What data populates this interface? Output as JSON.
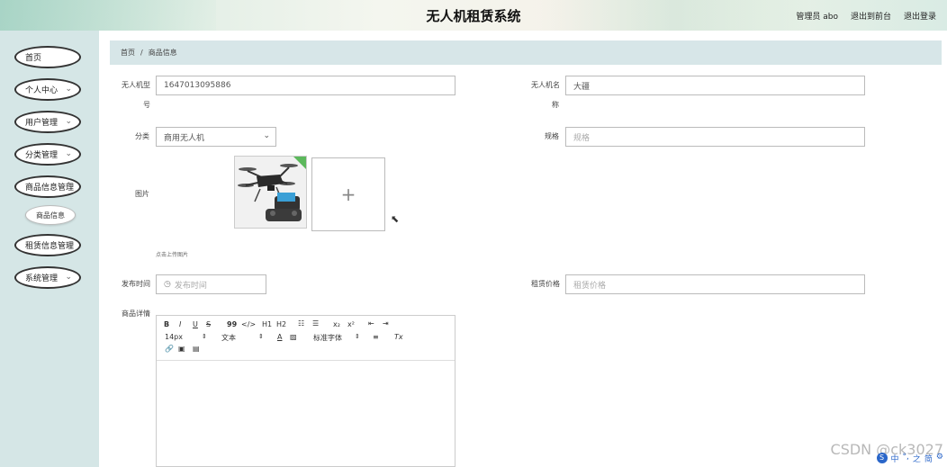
{
  "header": {
    "title": "无人机租赁系统",
    "links": [
      "管理员 abo",
      "退出到前台",
      "退出登录"
    ]
  },
  "sidebar": {
    "items": [
      {
        "label": "首页"
      },
      {
        "label": "个人中心"
      },
      {
        "label": "用户管理"
      },
      {
        "label": "分类管理"
      },
      {
        "label": "商品信息管理"
      },
      {
        "label": "商品信息",
        "sub": true
      },
      {
        "label": "租赁信息管理"
      },
      {
        "label": "系统管理"
      }
    ]
  },
  "breadcrumb": {
    "home": "首页",
    "sep": "/",
    "current": "商品信息"
  },
  "form": {
    "model_label_1": "无人机型",
    "model_label_2": "号",
    "model_value": "1647013095886",
    "name_label_1": "无人机名",
    "name_label_2": "称",
    "name_value": "大疆",
    "category_label": "分类",
    "category_value": "商用无人机",
    "spec_label": "规格",
    "spec_placeholder": "规格",
    "image_label": "图片",
    "upload_hint": "点击上传图片",
    "publish_label": "发布时间",
    "publish_placeholder": "发布时间",
    "price_label": "租赁价格",
    "price_placeholder": "租赁价格",
    "detail_label": "商品详情"
  },
  "editor": {
    "font_size": "14px",
    "paragraph": "文本",
    "font_family": "标准字体",
    "btn_bold": "B",
    "btn_italic": "I",
    "btn_underline": "U",
    "btn_strike": "S",
    "btn_quote": "99",
    "btn_code": "</>",
    "btn_h1": "H1",
    "btn_h2": "H2",
    "btn_sub": "x₂",
    "btn_sup": "x²",
    "btn_color": "A",
    "btn_clear": "Tx"
  },
  "watermark": "CSDN @ck3027",
  "ime": [
    "中",
    "°,",
    "之",
    "简",
    "⚙"
  ],
  "colors": {
    "sidebar_bg": "#d5e6e6",
    "breadcrumb_bg": "#d7e6e8",
    "success_badge": "#5cb85c"
  }
}
